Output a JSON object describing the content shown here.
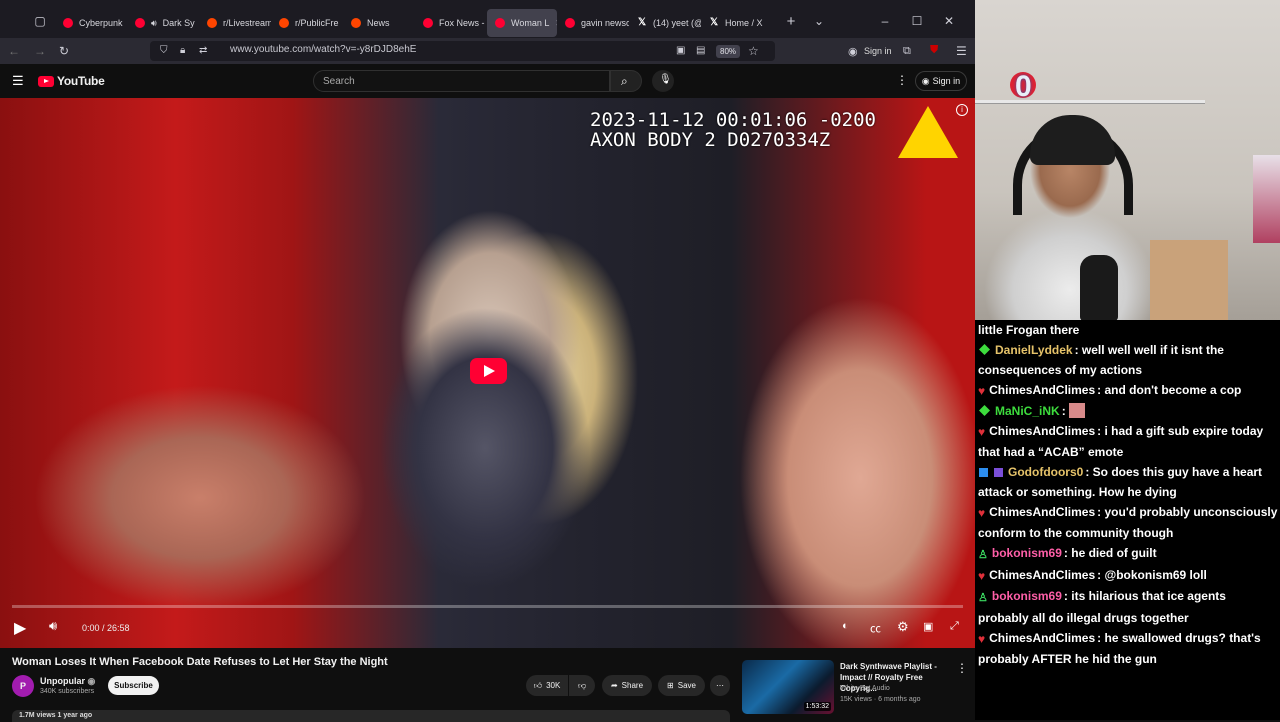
{
  "browser": {
    "tabs": [
      {
        "label": "Cyberpunk",
        "icon": "youtube-icon"
      },
      {
        "label": "Dark Sy",
        "icon": "youtube-icon",
        "audio": true
      },
      {
        "label": "r/Livestream",
        "icon": "reddit-icon"
      },
      {
        "label": "r/PublicFre",
        "icon": "reddit-icon"
      },
      {
        "label": "News",
        "icon": "reddit-icon"
      },
      {
        "label": "Fox News -",
        "icon": "youtube-icon"
      },
      {
        "label": "Woman L",
        "icon": "youtube-icon",
        "active": true
      },
      {
        "label": "gavin newso",
        "icon": "youtube-icon"
      },
      {
        "label": "(14) yeet (@",
        "icon": "x-icon"
      },
      {
        "label": "Home / X",
        "icon": "x-icon"
      }
    ],
    "url": "www.youtube.com/watch?v=-y8rDJD8ehE",
    "zoom": "80%",
    "signin": "Sign in"
  },
  "youtube": {
    "logo": "YouTube",
    "search_placeholder": "Search",
    "signin": "Sign in",
    "video": {
      "osd_line1": "2023-11-12 00:01:06 -0200",
      "osd_line2": "AXON BODY 2 D0270334Z",
      "time": "0:00 / 26:58",
      "progress": 0
    },
    "title": "Woman Loses It When Facebook Date Refuses to Let Her Stay the Night",
    "channel": {
      "avatar": "P",
      "name": "Unpopular",
      "subs": "340K subscribers"
    },
    "subscribe": "Subscribe",
    "likes": "30K",
    "share": "Share",
    "save": "Save",
    "views": "1.7M views  1 year ago",
    "recommended": {
      "title": "Dark Synthwave Playlist - Impact // Royalty Free Copyrig...",
      "channel": "White Bat Audio",
      "meta": "15K views · 6 months ago",
      "duration": "1:53:32"
    }
  },
  "stream": {
    "counter": "0"
  },
  "chat": [
    {
      "badge": "none",
      "user": "",
      "user_color": "#ffffff",
      "text": "little Frogan there"
    },
    {
      "badge": "green",
      "user": "DanielLyddek",
      "user_color": "#e6c36a",
      "text": "well well well if it isnt the consequences of my actions"
    },
    {
      "badge": "heart",
      "user": "ChimesAndClimes",
      "user_color": "#ffffff",
      "text": "and don't become a cop"
    },
    {
      "badge": "green",
      "user": "MaNiC_iNK",
      "user_color": "#3ddc3d",
      "text": "",
      "emote": true
    },
    {
      "badge": "heart",
      "user": "ChimesAndClimes",
      "user_color": "#ffffff",
      "text": "i had a gift sub expire today that had a “ACAB” emote"
    },
    {
      "badge": "bluepurple",
      "user": "Godofdoors0",
      "user_color": "#e6c36a",
      "text": "So does this guy have a heart attack or something. How he dying"
    },
    {
      "badge": "heart",
      "user": "ChimesAndClimes",
      "user_color": "#ffffff",
      "text": "you'd probably unconsciously conform to the community though"
    },
    {
      "badge": "person",
      "user": "bokonism69",
      "user_color": "#ff5fa8",
      "text": "he died of guilt"
    },
    {
      "badge": "heart",
      "user": "ChimesAndClimes",
      "user_color": "#ffffff",
      "text": "@bokonism69 loll"
    },
    {
      "badge": "person",
      "user": "bokonism69",
      "user_color": "#ff5fa8",
      "text": "its hilarious that ice agents probably all do illegal drugs together"
    },
    {
      "badge": "heart",
      "user": "ChimesAndClimes",
      "user_color": "#ffffff",
      "text": "he swallowed drugs? that's probably AFTER he hid the gun"
    }
  ]
}
